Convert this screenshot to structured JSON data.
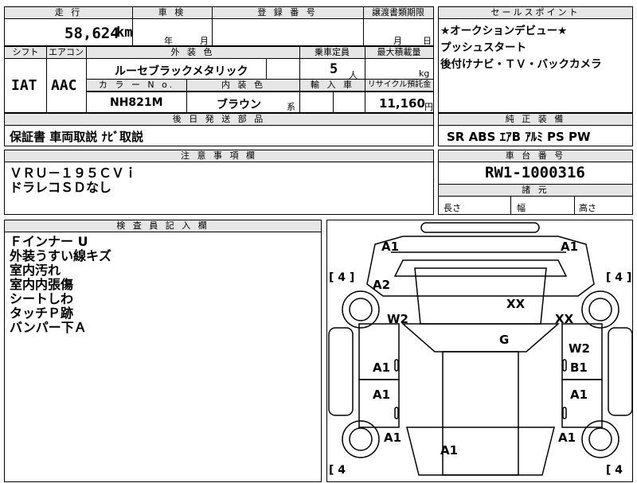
{
  "headers": {
    "mileage": "走 行",
    "inspection": "車 検",
    "registration": "登 録 番 号",
    "transfer_deadline": "譲渡書類期限",
    "sales_point": "セールスポイント",
    "shift": "シフト",
    "aircon": "エアコン",
    "exterior_color": "外 装 色",
    "capacity": "乗車定員",
    "max_load": "最大積載量",
    "color_no": "カ ラ ー N o.",
    "interior_color": "内 装 色",
    "import": "輸 入 車",
    "recycle": "リサイクル預託金",
    "later_parts": "後 日 発 送 部 品",
    "genuine_equip": "純 正 装 備",
    "notes": "注 意 事 項 欄",
    "chassis_no": "車 台 番 号",
    "dimensions": "諸 元",
    "inspector_notes": "検 査 員 記 入 欄"
  },
  "vehicle": {
    "mileage": "58,624",
    "mileage_unit": "km",
    "inspection_year": "年",
    "inspection_month": "月",
    "transfer_month": "月",
    "transfer_day": "日",
    "shift": "IAT",
    "aircon": "AAC",
    "exterior_color": "ルーセブラックメタリック",
    "capacity": "5",
    "capacity_unit": "人",
    "max_load_unit": "kg",
    "color_no": "NH821M",
    "interior_color": "ブラウン",
    "interior_suffix": "系",
    "recycle_fee": "11,160",
    "recycle_unit": "円",
    "chassis_no": "RW1-1000316"
  },
  "sales_points": [
    "★オークションデビュー★",
    "プッシュスタート",
    "後付けナビ・ＴＶ・バックカメラ"
  ],
  "later_parts": "保証書 車両取説 ﾅﾋﾞ取説",
  "genuine_equipment": "SR ABS ｴｱB ｱﾙﾐ PS PW",
  "notes": [
    "ＶＲＵ－１９５ＣＶｉ",
    "ドラレコＳＤなし"
  ],
  "dimension_labels": {
    "length": "長さ",
    "width": "幅",
    "height": "高さ"
  },
  "inspector_notes": [
    "Ｆインナー U",
    "外装うすい線キズ",
    "室内汚れ",
    "室内内張傷",
    "シートしわ",
    "タッチＰ跡",
    "バンパー下Ａ"
  ],
  "diagram": {
    "tire_tl": "[ 4 ]",
    "tire_tr": "[ 4 ]",
    "tire_bl": "[ 4",
    "tire_br": "[ 4",
    "marks": {
      "front_left": "A1",
      "front_right": "A1",
      "fender_left": "A2",
      "hood": "XX",
      "w2_left": "W2",
      "xx_right": "XX",
      "windshield_g": "G",
      "w2_right": "W2",
      "door_fl": "A1",
      "door_fr": "B1",
      "door_rl": "A1",
      "door_rr": "A1",
      "rear_fender_left": "A1",
      "rear_fender_right": "A1",
      "rear_center": "A1"
    }
  }
}
